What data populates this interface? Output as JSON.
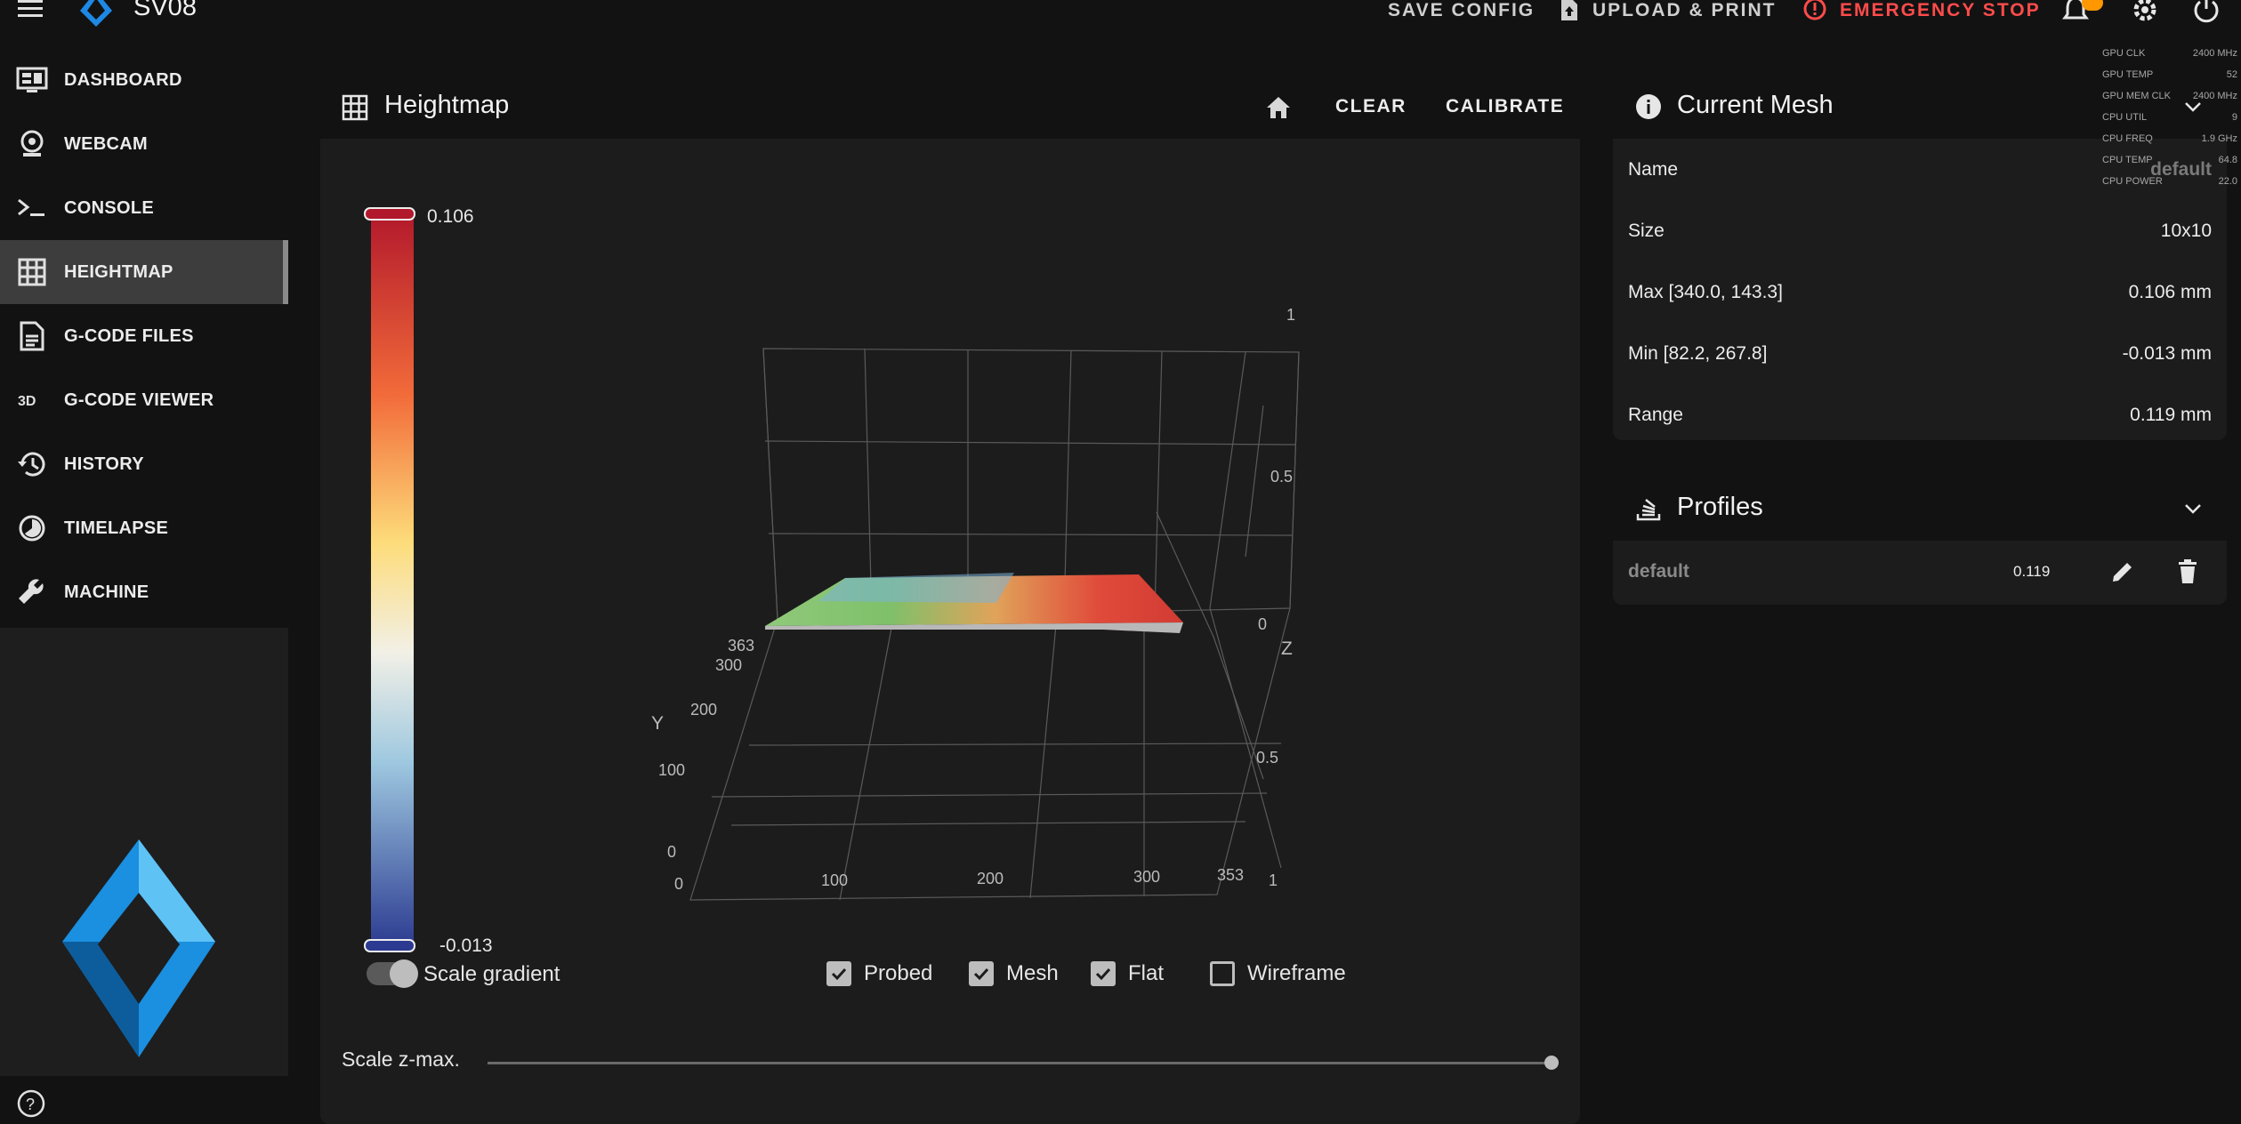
{
  "app": {
    "title": "SV08"
  },
  "toolbar": {
    "save_config": "SAVE CONFIG",
    "upload_print": "UPLOAD & PRINT",
    "emergency_stop": "EMERGENCY STOP"
  },
  "sidebar": {
    "items": [
      {
        "label": "DASHBOARD",
        "icon": "monitor-dashboard-icon"
      },
      {
        "label": "WEBCAM",
        "icon": "webcam-icon"
      },
      {
        "label": "CONSOLE",
        "icon": "console-icon"
      },
      {
        "label": "HEIGHTMAP",
        "icon": "grid-icon",
        "active": true
      },
      {
        "label": "G-CODE FILES",
        "icon": "file-document-icon"
      },
      {
        "label": "G-CODE VIEWER",
        "icon": "3d-icon"
      },
      {
        "label": "HISTORY",
        "icon": "history-icon"
      },
      {
        "label": "TIMELAPSE",
        "icon": "timelapse-icon"
      },
      {
        "label": "MACHINE",
        "icon": "wrench-icon"
      }
    ]
  },
  "heightmap": {
    "title": "Heightmap",
    "clear": "CLEAR",
    "calibrate": "CALIBRATE",
    "scale_max": "0.106",
    "scale_min": "-0.013",
    "axis": {
      "x_ticks": [
        "0",
        "100",
        "200",
        "300",
        "353"
      ],
      "y_ticks": [
        "0",
        "100",
        "200",
        "300",
        "363"
      ],
      "z_ticks_upper": [
        "1",
        "0.5",
        "0"
      ],
      "z_ticks_lower": [
        "0.5",
        "1"
      ],
      "y_label": "Y",
      "z_label": "Z"
    },
    "scale_gradient": "Scale gradient",
    "options": [
      {
        "label": "Probed",
        "checked": true
      },
      {
        "label": "Mesh",
        "checked": true
      },
      {
        "label": "Flat",
        "checked": true
      },
      {
        "label": "Wireframe",
        "checked": false
      }
    ],
    "scale_zmax_label": "Scale z-max.",
    "colors": {
      "high": "#b2182b",
      "low": "#2c3b91"
    }
  },
  "current_mesh": {
    "title": "Current Mesh",
    "rows": [
      {
        "k": "Name",
        "v": "default"
      },
      {
        "k": "Size",
        "v": "10x10"
      },
      {
        "k": "Max [340.0, 143.3]",
        "v": "0.106 mm"
      },
      {
        "k": "Min [82.2, 267.8]",
        "v": "-0.013 mm"
      },
      {
        "k": "Range",
        "v": "0.119 mm"
      }
    ]
  },
  "profiles": {
    "title": "Profiles",
    "items": [
      {
        "name": "default",
        "value": "0.119"
      }
    ]
  },
  "stats_overlay": [
    {
      "k": "GPU CLK",
      "v": "2400 MHz"
    },
    {
      "k": "GPU TEMP",
      "v": "52"
    },
    {
      "k": "GPU MEM CLK",
      "v": "2400 MHz"
    },
    {
      "k": "CPU UTIL",
      "v": "9"
    },
    {
      "k": "CPU FREQ",
      "v": "1.9 GHz"
    },
    {
      "k": "CPU TEMP",
      "v": "64.8"
    },
    {
      "k": "CPU POWER",
      "v": "22.0"
    }
  ]
}
